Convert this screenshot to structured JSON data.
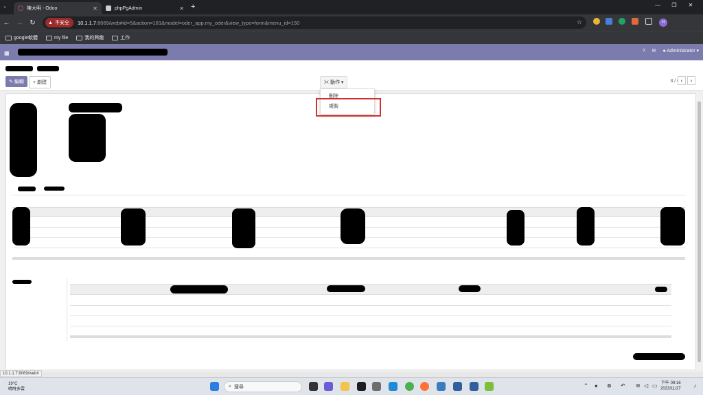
{
  "browser": {
    "tabs": [
      {
        "title": "陳大明 - Odoo",
        "favicon_color": "#a0486d"
      },
      {
        "title": "phpPgAdmin",
        "favicon_color": "#cfcfcf"
      }
    ],
    "security_label": "不安全",
    "url_host": "10.1.1.7",
    "url_rest": ":8069/web#id=5&action=181&model=oder_app.my_oder&view_type=form&menu_id=150",
    "profile_initial": "H",
    "bookmarks": [
      "google軟體",
      "my file",
      "我的興趣",
      "工作"
    ]
  },
  "odoo": {
    "user": "Administrator",
    "edit_label": "編輯",
    "create_label": "創建",
    "action_label": "動作",
    "action_menu": [
      "刪除",
      "複製"
    ],
    "pager": "3 / 6"
  },
  "status_url": "10.1.1.7:8069/web#",
  "taskbar": {
    "temp": "19°C",
    "weather": "晴時多雲",
    "search_placeholder": "搜尋",
    "time": "下午 09:16",
    "date": "2023/11/27"
  }
}
